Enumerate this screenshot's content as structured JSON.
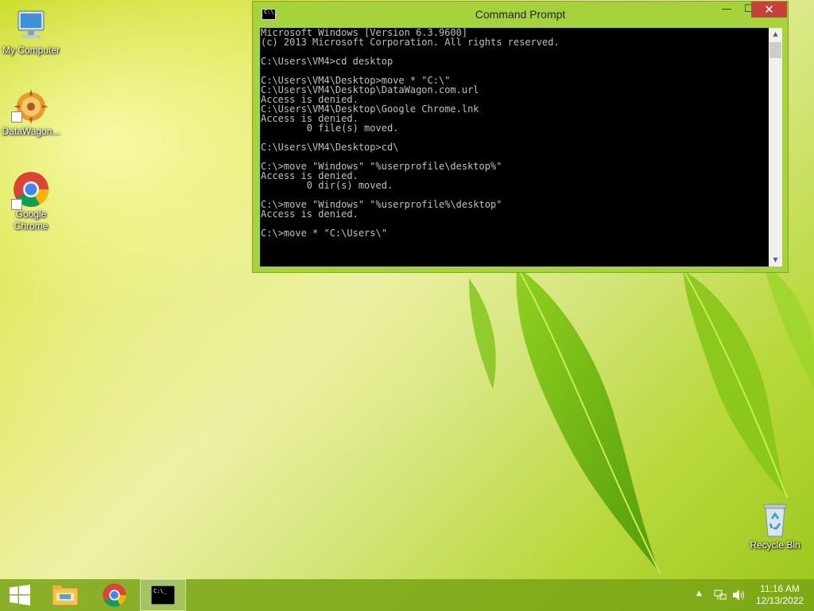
{
  "desktop": {
    "icons": [
      {
        "label": "My Computer"
      },
      {
        "label": "DataWagon..."
      },
      {
        "label": "Google Chrome"
      },
      {
        "label": "Recycle Bin"
      }
    ]
  },
  "window": {
    "title": "Command Prompt",
    "controls": {
      "minimize": "—",
      "maximize": "☐",
      "close": "✕"
    },
    "console_lines": [
      "Microsoft Windows [Version 6.3.9600]",
      "(c) 2013 Microsoft Corporation. All rights reserved.",
      "",
      "C:\\Users\\VM4>cd desktop",
      "",
      "C:\\Users\\VM4\\Desktop>move * \"C:\\\"",
      "C:\\Users\\VM4\\Desktop\\DataWagon.com.url",
      "Access is denied.",
      "C:\\Users\\VM4\\Desktop\\Google Chrome.lnk",
      "Access is denied.",
      "        0 file(s) moved.",
      "",
      "C:\\Users\\VM4\\Desktop>cd\\",
      "",
      "C:\\>move \"Windows\" \"%userprofile\\desktop%\"",
      "Access is denied.",
      "        0 dir(s) moved.",
      "",
      "C:\\>move \"Windows\" \"%userprofile%\\desktop\"",
      "Access is denied.",
      "",
      "C:\\>move * \"C:\\Users\\\""
    ]
  },
  "taskbar": {
    "items": [
      "start",
      "file-explorer",
      "google-chrome",
      "command-prompt"
    ],
    "active_item": "command-prompt"
  },
  "tray": {
    "time": "11:16 AM",
    "date": "12/13/2022"
  },
  "colors": {
    "window_frame": "#a6d33c",
    "close_button": "#c7403a",
    "console_bg": "#000000",
    "console_text": "#c0c0c0"
  }
}
